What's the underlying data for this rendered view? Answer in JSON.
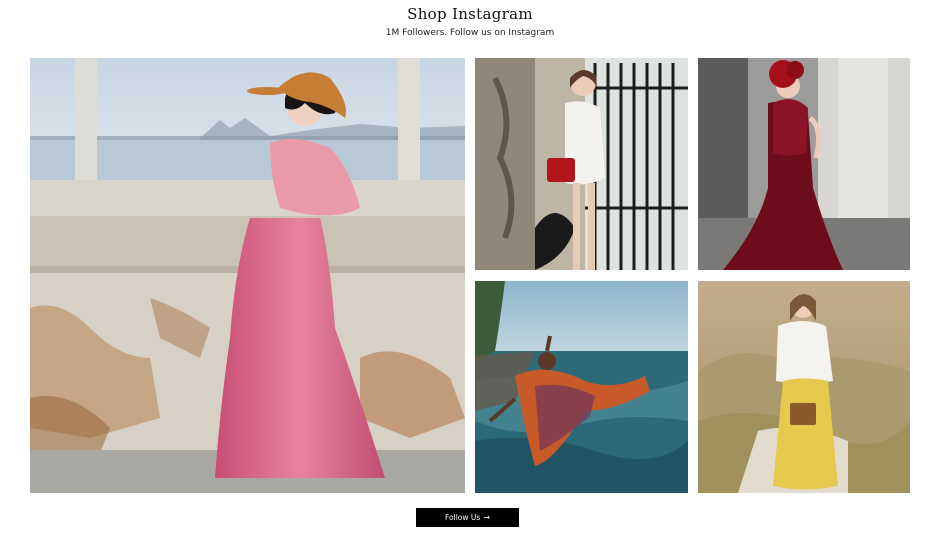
{
  "header": {
    "title": "Shop Instagram",
    "subtitle": "1M Followers. Follow us on Instagram"
  },
  "cta": {
    "label": "Follow Us",
    "icon": "→"
  }
}
